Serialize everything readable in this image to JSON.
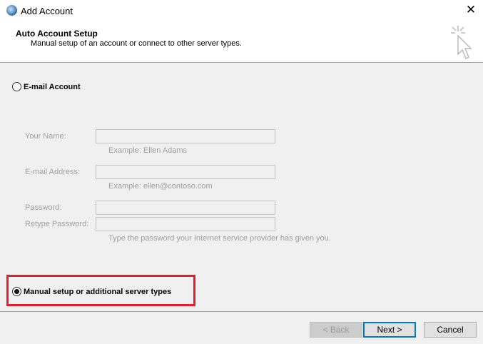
{
  "window": {
    "title": "Add Account"
  },
  "header": {
    "title": "Auto Account Setup",
    "subtitle": "Manual setup of an account or connect to other server types."
  },
  "options": {
    "email_account": "E-mail Account",
    "manual_setup": "Manual setup or additional server types",
    "selected": "manual_setup"
  },
  "form": {
    "your_name": {
      "label": "Your Name:",
      "value": "",
      "hint": "Example: Ellen Adams"
    },
    "email": {
      "label": "E-mail Address:",
      "value": "",
      "hint": "Example: ellen@contoso.com"
    },
    "password": {
      "label": "Password:",
      "value": ""
    },
    "retype_password": {
      "label": "Retype Password:",
      "value": "",
      "hint": "Type the password your Internet service provider has given you."
    }
  },
  "buttons": {
    "back": "< Back",
    "next": "Next >",
    "cancel": "Cancel"
  },
  "colors": {
    "highlight": "#e0202a",
    "next_border": "#0078d7"
  }
}
